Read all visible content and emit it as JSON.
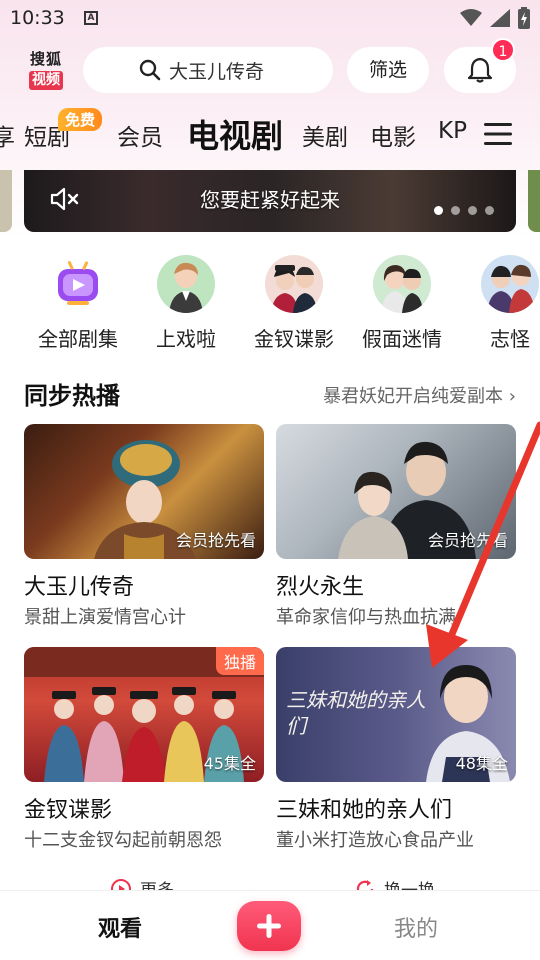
{
  "status_bar": {
    "time": "10:33",
    "notification_letter": "A"
  },
  "header": {
    "logo_top": "搜狐",
    "logo_bottom": "视频",
    "search_text": "大玉儿传奇",
    "filter_label": "筛选",
    "bell_badge": "1"
  },
  "tabs": {
    "free_badge": "免费",
    "items": [
      {
        "label": "享"
      },
      {
        "label": "短剧"
      },
      {
        "label": "会员"
      },
      {
        "label": "电视剧"
      },
      {
        "label": "美剧"
      },
      {
        "label": "电影"
      },
      {
        "label": "KP"
      }
    ],
    "active_index": 3
  },
  "banner": {
    "caption": "您要赶紧好起来",
    "dot_count": 4,
    "active_dot": 0
  },
  "categories": [
    {
      "label": "全部剧集",
      "icon": "tv-icon"
    },
    {
      "label": "上戏啦",
      "icon": "avatar-male"
    },
    {
      "label": "金钗谍影",
      "icon": "avatar-pair"
    },
    {
      "label": "假面迷情",
      "icon": "avatar-couple"
    },
    {
      "label": "志怪",
      "icon": "avatar-group"
    }
  ],
  "section": {
    "title": "同步热播",
    "more_text": "暴君妖妃开启纯爱副本"
  },
  "cards": [
    {
      "title": "大玉儿传奇",
      "subtitle": "景甜上演爱情宫心计",
      "tag": "会员抢先看",
      "flag": ""
    },
    {
      "title": "烈火永生",
      "subtitle": "革命家信仰与热血抗满",
      "tag": "会员抢先看",
      "flag": ""
    },
    {
      "title": "金钗谍影",
      "subtitle": "十二支金钗勾起前朝恩怨",
      "tag": "45集全",
      "flag": "独播"
    },
    {
      "title": "三妹和她的亲人们",
      "subtitle": "董小米打造放心食品产业",
      "tag": "48集全",
      "flag": "",
      "poster_text": "三妹和她的亲人们"
    }
  ],
  "footer_row": {
    "more_label": "更多",
    "refresh_label": "换一换"
  },
  "bottom_nav": {
    "watch_label": "观看",
    "mine_label": "我的"
  },
  "colors": {
    "accent": "#f0344f",
    "badge": "#ff2d55",
    "free_badge": "#ff9a22",
    "annotation_arrow": "#e8362c"
  }
}
